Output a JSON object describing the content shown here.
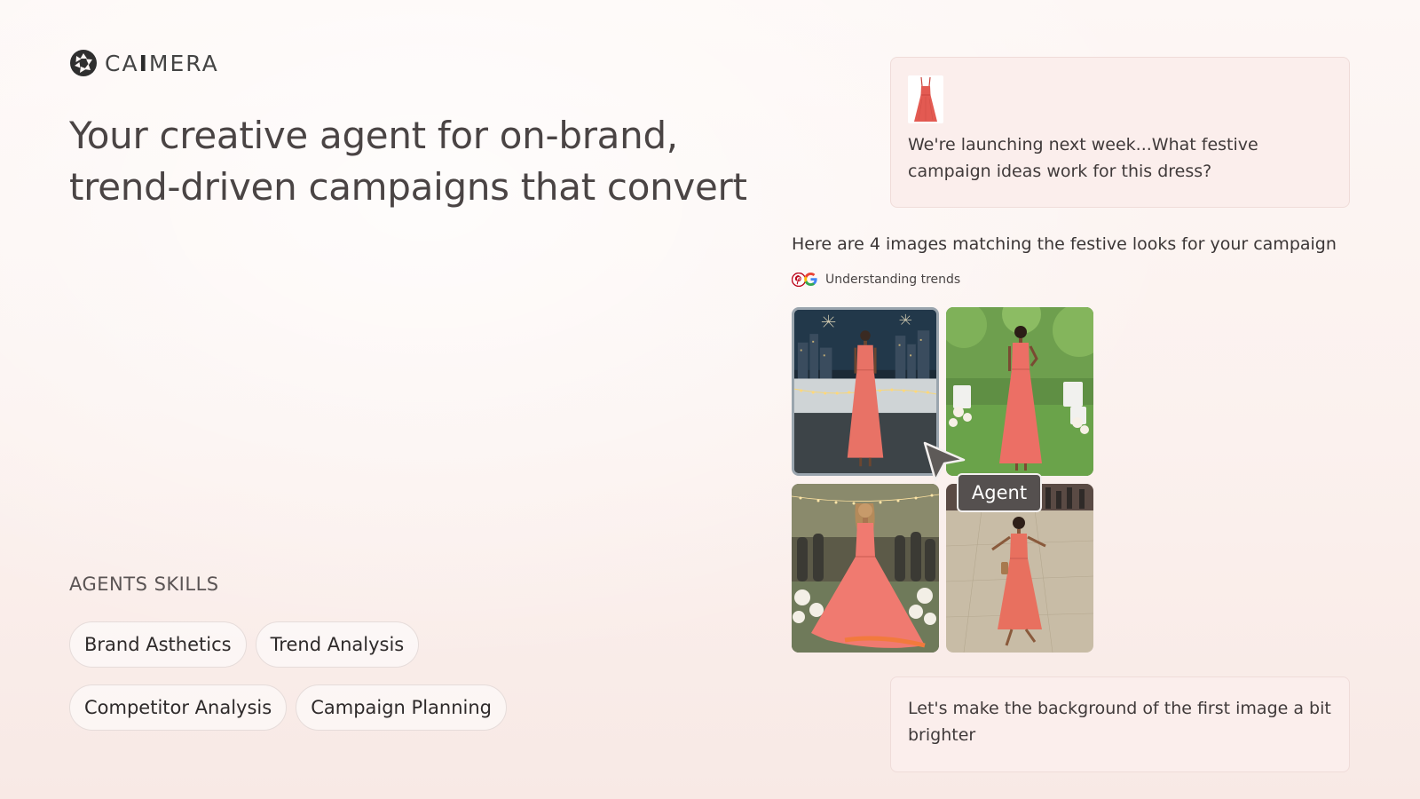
{
  "brand": {
    "logo_text_prefix": "CA",
    "logo_text_bold": "I",
    "logo_text_suffix": "MERA"
  },
  "hero": {
    "headline": "Your creative agent for on-brand, trend-driven campaigns that convert"
  },
  "skills": {
    "title": "AGENTS SKILLS",
    "items": [
      {
        "label": "Brand Asthetics"
      },
      {
        "label": "Trend Analysis"
      },
      {
        "label": "Competitor Analysis"
      },
      {
        "label": "Campaign Planning"
      }
    ]
  },
  "chat": {
    "user_message_1": "We're launching next week...What festive campaign ideas work for this dress?",
    "agent_reply": "Here are 4 images matching the festive looks for your campaign",
    "status_label": "Understanding trends",
    "status_icons": [
      "pinterest-icon",
      "google-icon"
    ],
    "cursor_label": "Agent",
    "user_message_2": "Let's make the background of the first image a bit brighter"
  },
  "images": [
    {
      "icon": "city-fireworks-photo"
    },
    {
      "icon": "garden-party-photo"
    },
    {
      "icon": "wedding-twirl-photo"
    },
    {
      "icon": "plaza-walk-photo"
    }
  ],
  "colors": {
    "accent_dress": "#e8635a",
    "bubble_bg": "#fbeeec",
    "tag_bg": "#55504f"
  }
}
